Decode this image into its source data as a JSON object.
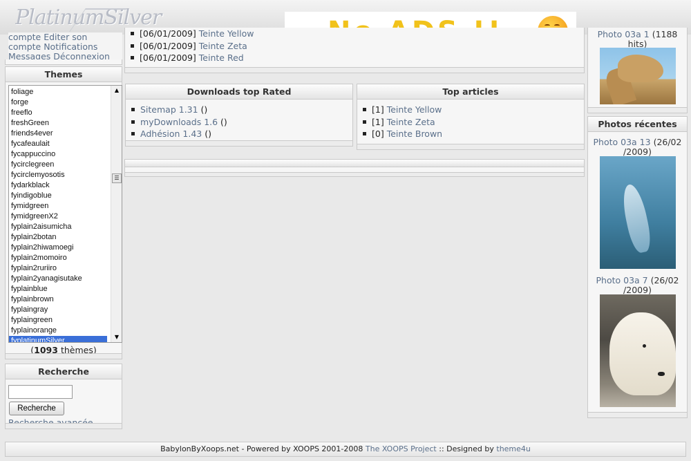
{
  "header": {
    "logo_text": "PlatinumSilver",
    "banner_text": "No ADS !!"
  },
  "user_menu": {
    "line1": "compte Editer son",
    "line2": "compte Notifications",
    "messages": "Messages",
    "logout": "Déconnexion"
  },
  "themes": {
    "title": "Themes",
    "items": [
      "foliage",
      "forge",
      "freeflo",
      "freshGreen",
      "friends4ever",
      "fycafeaulait",
      "fycappuccino",
      "fycirclegreen",
      "fycirclemyosotis",
      "fydarkblack",
      "fyindigoblue",
      "fymidgreen",
      "fymidgreenX2",
      "fyplain2aisumicha",
      "fyplain2botan",
      "fyplain2hiwamoegi",
      "fyplain2momoiro",
      "fyplain2ruriiro",
      "fyplain2yanagisutake",
      "fyplainblue",
      "fyplainbrown",
      "fyplaingray",
      "fyplaingreen",
      "fyplainorange",
      "fyplatinumSilver"
    ],
    "selected": "fyplatinumSilver",
    "count_open": "(",
    "count": "1093",
    "count_label": "thèmes)"
  },
  "search": {
    "title": "Recherche",
    "value": "",
    "button": "Recherche",
    "advanced": "Recherche avancée"
  },
  "news": {
    "items": [
      {
        "date": "[06/01/2009]",
        "title": "Teinte Yellow"
      },
      {
        "date": "[06/01/2009]",
        "title": "Teinte Zeta"
      },
      {
        "date": "[06/01/2009]",
        "title": "Teinte Red"
      }
    ]
  },
  "downloads": {
    "title": "Downloads top Rated",
    "items": [
      {
        "name": "Sitemap 1.31",
        "suffix": " ()"
      },
      {
        "name": "myDownloads 1.6",
        "suffix": " ()"
      },
      {
        "name": "Adhésion 1.43",
        "suffix": " ()"
      }
    ]
  },
  "top_articles": {
    "title": "Top articles",
    "items": [
      {
        "rank": "[1]",
        "title": "Teinte Yellow"
      },
      {
        "rank": "[1]",
        "title": "Teinte Zeta"
      },
      {
        "rank": "[0]",
        "title": "Teinte Brown"
      }
    ]
  },
  "popular_photo": {
    "caption_link": "Photo 03a 1",
    "caption_rest": " (1188",
    "caption_line2": "hits)"
  },
  "recent_photos": {
    "title": "Photos récentes",
    "items": [
      {
        "link": "Photo 03a 13",
        "date1": " (26/02",
        "date2": "/2009)"
      },
      {
        "link": "Photo 03a 7",
        "date1": " (26/02",
        "date2": "/2009)"
      }
    ]
  },
  "footer": {
    "text": "BabylonByXoops.net - Powered by XOOPS 2001-2008 ",
    "project_link": "The XOOPS Project",
    "designed_by": " :: Designed by ",
    "designer_link": "theme4u"
  }
}
